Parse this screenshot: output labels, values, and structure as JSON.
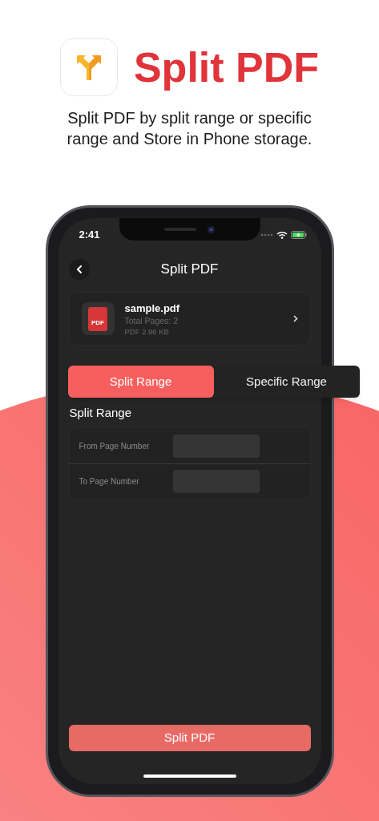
{
  "app_header": {
    "title": "Split PDF",
    "description": "Split PDF by split range or specific range and Store in Phone storage."
  },
  "status_bar": {
    "time": "2:41"
  },
  "nav": {
    "title": "Split PDF"
  },
  "file": {
    "icon_label": "PDF",
    "name": "sample.pdf",
    "pages": "Total Pages: 2",
    "info": "PDF 2.96 KB"
  },
  "tabs": [
    {
      "label": "Split Range",
      "selected": true
    },
    {
      "label": "Specific Range",
      "selected": false
    }
  ],
  "section_title": "Split Range",
  "fields": [
    {
      "label": "From Page Number"
    },
    {
      "label": "To Page Number"
    }
  ],
  "primary_button": "Split PDF"
}
